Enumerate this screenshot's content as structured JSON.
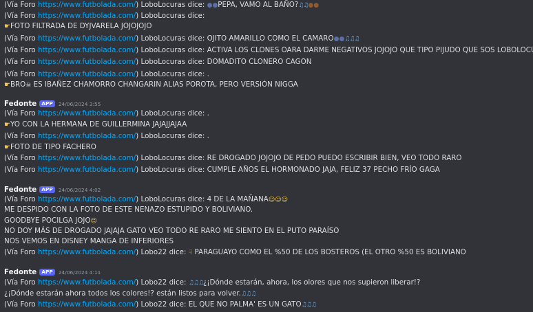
{
  "links": {
    "futbolada": "https://www.futbolada.com/"
  },
  "groups": [
    {
      "lines": [
        {
          "pre": "(Vía Foro ",
          "post": ") LoboLocuras dice: ",
          "text": "PEPA, VAMO AL BAÑO?",
          "emoji_before": [
            "bust-in-silhouette-icon",
            "bust-in-silhouette-icon"
          ],
          "emoji_after": [
            "musical-notes-icon",
            "poop-icon",
            "poop-icon"
          ]
        },
        {
          "pre": "(Vía Foro ",
          "post": ") LoboLocuras dice:"
        },
        {
          "text": "FOTO FILTRADA DE DYJVARELA JOJOJOJO",
          "emoji_before": [
            "pointing-hand-icon"
          ]
        },
        {
          "pre": "(Vía Foro ",
          "post": ") LoboLocuras dice: ",
          "text": "OJITO AMARILLO COMO EL CAMARO",
          "emoji_after": [
            "bust-in-silhouette-icon",
            "bust-in-silhouette-icon",
            "musical-notes-icon"
          ]
        },
        {
          "pre": "(Vía Foro ",
          "post": ") LoboLocuras dice: ",
          "text": "ACTIVA LOS CLONES OARA DARME NEGATIVOS JOJOJO QUE TIPO PIJUDO QUE SOS LOBOLOCURAS"
        },
        {
          "pre": "(Vía Foro ",
          "post": ") LoboLocuras dice: ",
          "text": "DOMADITO CLONERO CAGON"
        },
        {
          "pre": "(Vía Foro ",
          "post": ") LoboLocuras dice: ",
          "text": "."
        },
        {
          "text": "ES IBAÑEZ CHAMORRO CHANGARIN ALIAS POROTA, PERO VERSIÓN NIGGA",
          "emoji_before": [
            "pointing-hand-icon"
          ],
          "prefix": "BRO",
          "emoji_mid": [
            "skull-icon"
          ]
        }
      ]
    },
    {
      "username": "Fedonte",
      "badge": "APP",
      "timestamp": "24/06/2024 3:55",
      "lines": [
        {
          "pre": "(Vía Foro ",
          "post": ") LoboLocuras dice: ",
          "text": "."
        },
        {
          "text": "YO CON LA HERMANA DE GUILLERMINA JAJAJJAJAA",
          "emoji_before": [
            "pointing-hand-icon"
          ]
        },
        {
          "pre": "(Vía Foro ",
          "post": ") LoboLocuras dice: ",
          "text": "."
        },
        {
          "text": "FOTO DE TIPO FACHERO",
          "emoji_before": [
            "pointing-hand-icon"
          ]
        },
        {
          "pre": "(Vía Foro ",
          "post": ") LoboLocuras dice: ",
          "text": "RE DROGADO JOJOJO DE PEDO PUEDO ESCRIBIR BIEN, VEO TODO RARO"
        },
        {
          "pre": "(Vía Foro ",
          "post": ") LoboLocuras dice: ",
          "text": "CUMPLE AÑOS EL HORMONADO JAJA, FELIZ 37 PECHO FRÍO GAGA"
        }
      ]
    },
    {
      "username": "Fedonte",
      "badge": "APP",
      "timestamp": "24/06/2024 4:02",
      "lines": [
        {
          "pre": "(Vía Foro ",
          "post": ") LoboLocuras dice: ",
          "text": "4 DE LA MAÑANA",
          "emoji_after": [
            "yum-face-icon",
            "yum-face-icon",
            "yum-face-icon"
          ]
        },
        {
          "text": "ME DESPIDO CON LA FOTO DE ESTE NENAZO ESTUPIDO Y BOLIVIANO."
        },
        {
          "text": "GOODBYE POCILGA JOJO",
          "emoji_after": [
            "shushing-face-icon"
          ]
        },
        {
          "text": "NO DOY MÁS DE DROGADO JAJAJA GATO VEO TODO RE RARO ME SIENTO EN EL PUTO PARAÍSO"
        },
        {
          "text": "NOS VEMOS EN DISNEY MANGA DE INFERIORES"
        },
        {
          "pre": "(Vía Foro ",
          "post": ") Lobo22 dice: ",
          "text": " PARAGUAYO COMO EL %50 DE LOS BOSTEROS (EL OTRO %50 ES BOLIVIANO",
          "emoji_mid_start": [
            "pointing-down-icon"
          ]
        }
      ]
    },
    {
      "username": "Fedonte",
      "badge": "APP",
      "timestamp": "24/06/2024 4:11",
      "lines": [
        {
          "pre": "(Vía Foro ",
          "post": ") Lobo22 dice: ",
          "text": "¿¡Dónde estarán, ahora, los olores que nos supieron liberar!?",
          "emoji_mid_start": [
            "musical-notes-icon"
          ]
        },
        {
          "text": "¿¡Dónde estarán ahora todos los colores!? están listos para volver.",
          "emoji_after": [
            "musical-notes-icon"
          ]
        },
        {
          "pre": "(Vía Foro ",
          "post": ") Lobo22 dice: ",
          "text": "EL QUE NO PALMA' ES UN GATO",
          "emoji_after": [
            "musical-notes-icon"
          ]
        }
      ]
    }
  ]
}
